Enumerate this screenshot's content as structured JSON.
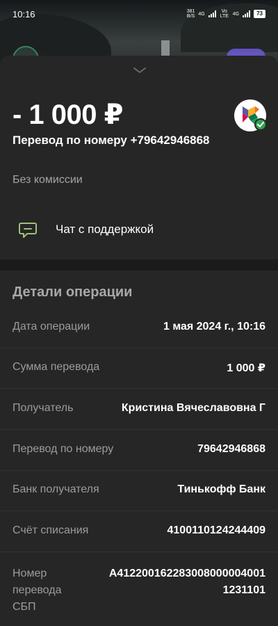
{
  "status_bar": {
    "time": "10:16",
    "net_speed_value": "381",
    "net_speed_unit": "B/S",
    "net1": "4G",
    "net2": "Vo LTE",
    "net3": "4G",
    "battery": "73"
  },
  "header": {
    "amount": "- 1 000 ₽",
    "subtitle": "Перевод по номеру +79642946868",
    "fee": "Без комиссии"
  },
  "support": {
    "label": "Чат с поддержкой"
  },
  "details": {
    "title": "Детали операции",
    "rows": [
      {
        "label": "Дата операции",
        "value": "1 мая 2024 г., 10:16"
      },
      {
        "label": "Сумма перевода",
        "value": "1 000 ₽"
      },
      {
        "label": "Получатель",
        "value": "Кристина Вячеславовна Г"
      },
      {
        "label": "Перевод по номеру",
        "value": "79642946868"
      },
      {
        "label": "Банк получателя",
        "value": "Тинькофф Банк"
      },
      {
        "label": "Счёт списания",
        "value": "4100110124244409"
      },
      {
        "label": "Номер перевода СБП",
        "value": "A4122001622830080000040011231101"
      }
    ]
  },
  "colors": {
    "sheet": "#262626",
    "label_gray": "#9c9c9c",
    "accent_green": "#2fa24f",
    "support_icon": "#9cc27a"
  }
}
